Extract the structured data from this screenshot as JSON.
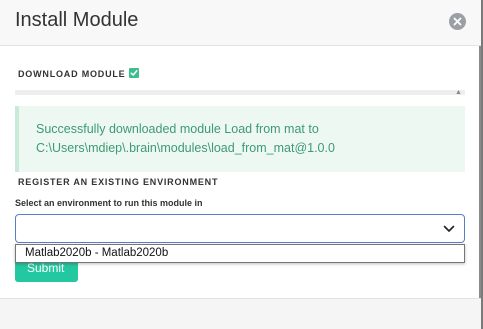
{
  "modal": {
    "title": "Install Module",
    "close_icon": "close-circle-icon"
  },
  "download": {
    "label": "DOWNLOAD MODULE",
    "status_icon": "check-icon",
    "status_color": "#3bbf8f",
    "progress_percent": 100
  },
  "alert": {
    "message": "Successfully downloaded module Load from mat to C:\\Users\\mdiep\\.brain\\modules\\load_from_mat@1.0.0",
    "text_color": "#3d9a73",
    "background": "#eef8f3"
  },
  "environment": {
    "section_label": "REGISTER AN EXISTING ENVIRONMENT",
    "field_label": "Select an environment to run this module in",
    "selected_value": "",
    "dropdown_icon": "chevron-down-icon",
    "options": [
      "Matlab2020b - Matlab2020b"
    ]
  },
  "actions": {
    "submit_label": "Submit",
    "submit_color": "#24c8a0"
  }
}
